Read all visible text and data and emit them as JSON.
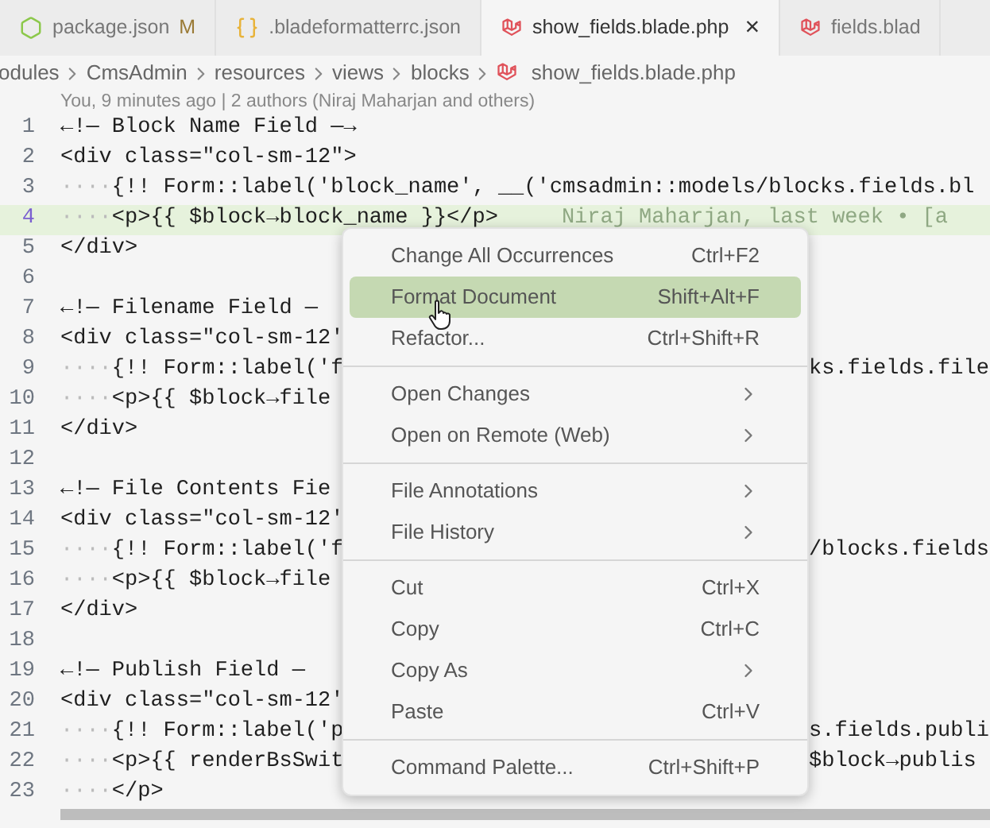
{
  "tabs": [
    {
      "label": "package.json",
      "badge": "M",
      "kind": "node",
      "selected": false
    },
    {
      "label": ".bladeformatterrc.json",
      "kind": "json",
      "selected": false
    },
    {
      "label": "show_fields.blade.php",
      "kind": "laravel",
      "selected": true,
      "close": "×"
    },
    {
      "label": "fields.blad",
      "kind": "laravel",
      "selected": false
    }
  ],
  "breadcrumb": [
    "odules",
    "CmsAdmin",
    "resources",
    "views",
    "blocks",
    "show_fields.blade.php"
  ],
  "blame_header": "You, 9 minutes ago | 2 authors (Niraj Maharjan and others)",
  "lines": [
    {
      "number": "1",
      "text": "←!— Block Name Field —→",
      "current": false
    },
    {
      "number": "2",
      "text": "<div class=\"col-sm-12\">",
      "current": false
    },
    {
      "number": "3",
      "indent": "····",
      "text": "{!! Form::label('block_name', __('cmsadmin::models/blocks.fields.bl",
      "current": false
    },
    {
      "number": "4",
      "indent": "····",
      "text": "<p>{{ $block→block_name }}</p>",
      "blame": "Niraj Maharjan, last week • [a",
      "current": true
    },
    {
      "number": "5",
      "text": "</div>",
      "current": false
    },
    {
      "number": "6",
      "current": false
    },
    {
      "number": "7",
      "text": "←!— Filename Field —",
      "current": false
    },
    {
      "number": "8",
      "text": "<div class=\"col-sm-12'",
      "current": false
    },
    {
      "number": "9",
      "indent": "····",
      "text": "{!! Form::label('f",
      "right": "ks.fields.file",
      "current": false
    },
    {
      "number": "10",
      "indent": "····",
      "text": "<p>{{ $block→file",
      "current": false
    },
    {
      "number": "11",
      "text": "</div>",
      "current": false
    },
    {
      "number": "12",
      "current": false
    },
    {
      "number": "13",
      "text": "←!— File Contents Fie",
      "current": false
    },
    {
      "number": "14",
      "text": "<div class=\"col-sm-12'",
      "current": false
    },
    {
      "number": "15",
      "indent": "····",
      "text": "{!! Form::label('f",
      "right": "/blocks.fields",
      "current": false
    },
    {
      "number": "16",
      "indent": "····",
      "text": "<p>{{ $block→file",
      "current": false
    },
    {
      "number": "17",
      "text": "</div>",
      "current": false
    },
    {
      "number": "18",
      "current": false
    },
    {
      "number": "19",
      "text": "←!— Publish Field —",
      "current": false
    },
    {
      "number": "20",
      "text": "<div class=\"col-sm-12'",
      "current": false
    },
    {
      "number": "21",
      "indent": "····",
      "text": "{!! Form::label('p",
      "right": "s.fields.publi",
      "current": false
    },
    {
      "number": "22",
      "indent": "····",
      "text": "<p>{{ renderBsSwit",
      "right": "$block→publis",
      "current": false
    },
    {
      "number": "23",
      "indent": "····",
      "text": "</p>",
      "current": false
    }
  ],
  "context_menu": [
    {
      "kind": "item",
      "label": "Change All Occurrences",
      "shortcut": "Ctrl+F2",
      "selected": false
    },
    {
      "kind": "item",
      "label": "Format Document",
      "shortcut": "Shift+Alt+F",
      "selected": true
    },
    {
      "kind": "item",
      "label": "Refactor...",
      "shortcut": "Ctrl+Shift+R",
      "selected": false
    },
    {
      "kind": "separator"
    },
    {
      "kind": "submenu",
      "label": "Open Changes",
      "selected": false
    },
    {
      "kind": "submenu",
      "label": "Open on Remote (Web)",
      "selected": false
    },
    {
      "kind": "separator"
    },
    {
      "kind": "submenu",
      "label": "File Annotations",
      "selected": false
    },
    {
      "kind": "submenu",
      "label": "File History",
      "selected": false
    },
    {
      "kind": "separator"
    },
    {
      "kind": "item",
      "label": "Cut",
      "shortcut": "Ctrl+X",
      "selected": false
    },
    {
      "kind": "item",
      "label": "Copy",
      "shortcut": "Ctrl+C",
      "selected": false
    },
    {
      "kind": "submenu",
      "label": "Copy As",
      "selected": false
    },
    {
      "kind": "item",
      "label": "Paste",
      "shortcut": "Ctrl+V",
      "selected": false
    },
    {
      "kind": "separator"
    },
    {
      "kind": "item",
      "label": "Command Palette...",
      "shortcut": "Ctrl+Shift+P",
      "selected": false
    }
  ]
}
